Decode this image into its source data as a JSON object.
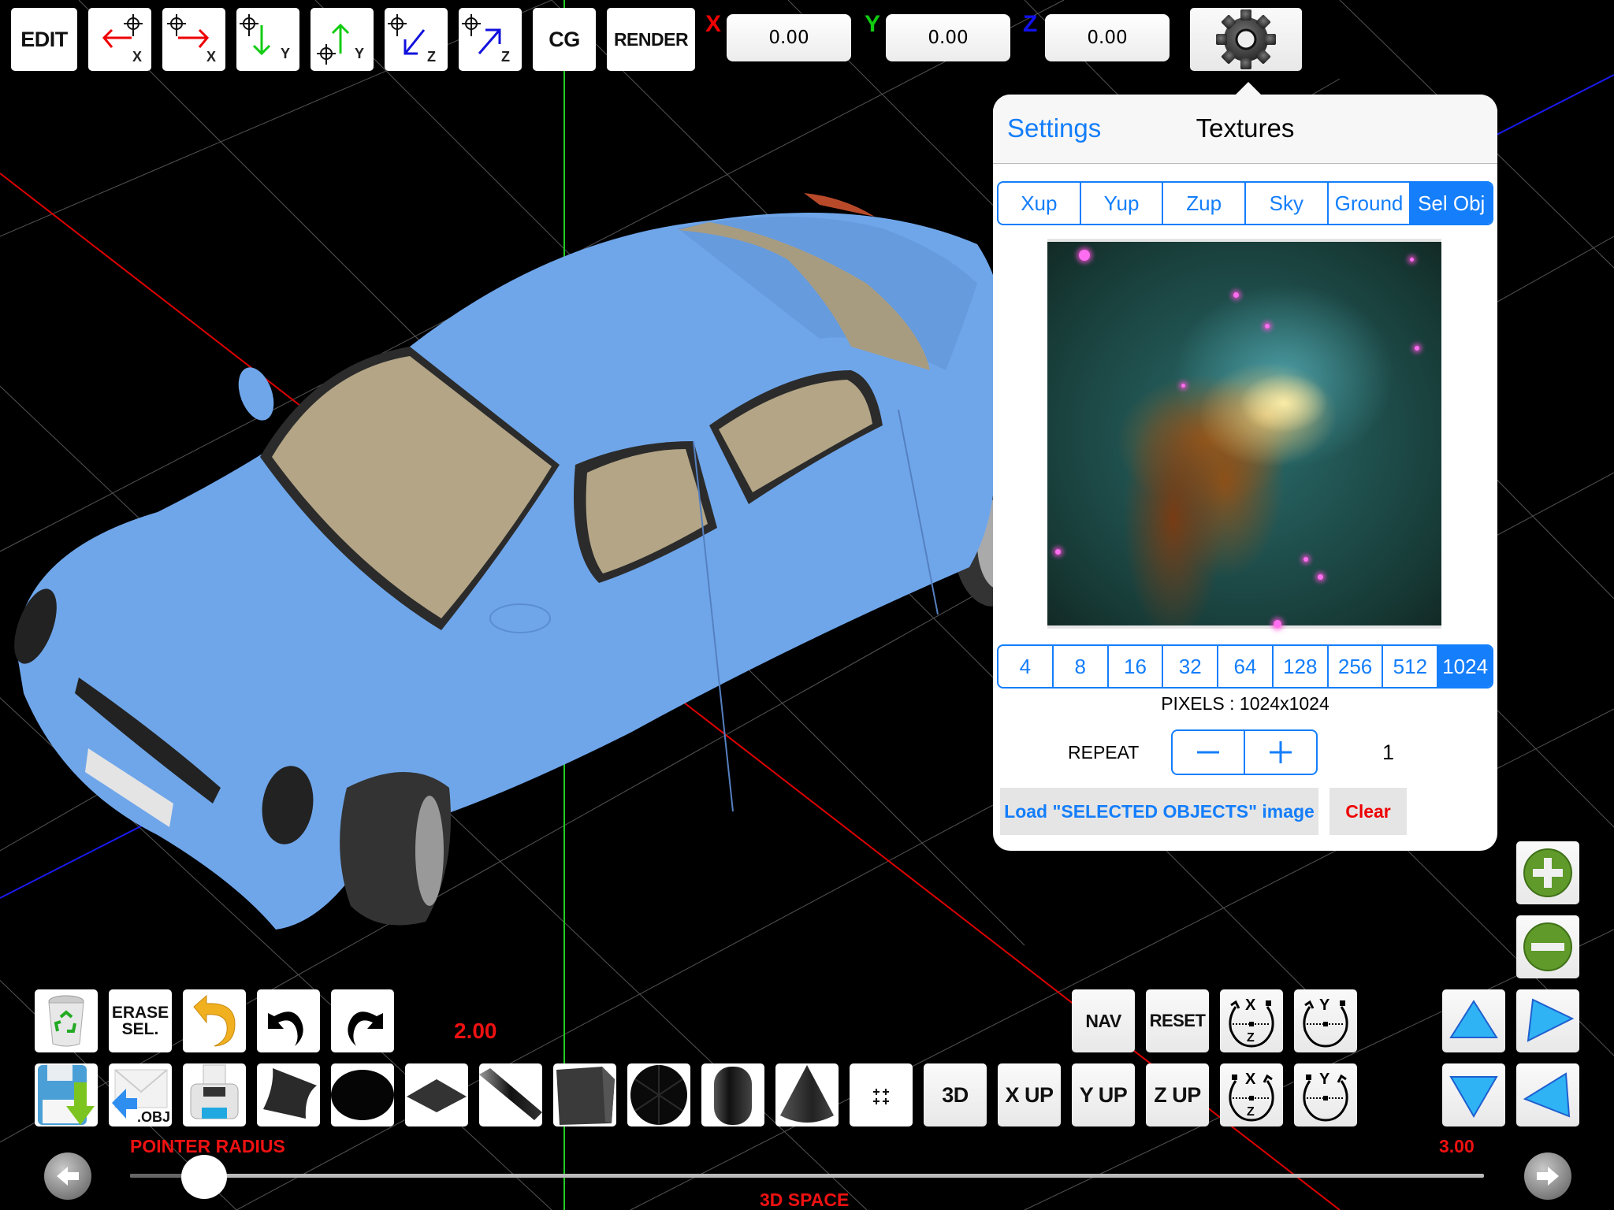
{
  "toolbar": {
    "edit": "EDIT",
    "cg": "CG",
    "render": "RENDER",
    "move_buttons": [
      {
        "axis": "X",
        "direction": "left"
      },
      {
        "axis": "X",
        "direction": "right"
      },
      {
        "axis": "Y",
        "direction": "down"
      },
      {
        "axis": "Y",
        "direction": "up"
      },
      {
        "axis": "Z",
        "direction": "toward"
      },
      {
        "axis": "Z",
        "direction": "away"
      }
    ],
    "coords": {
      "x_label": "X",
      "x_value": "0.00",
      "y_label": "Y",
      "y_value": "0.00",
      "z_label": "Z",
      "z_value": "0.00"
    },
    "settings_icon": "gear-icon"
  },
  "popover": {
    "back_label": "Settings",
    "title": "Textures",
    "texture_tabs": [
      "Xup",
      "Yup",
      "Zup",
      "Sky",
      "Ground",
      "Sel Obj"
    ],
    "texture_tab_active": "Sel Obj",
    "preview_description": "Nebula pillar texture image",
    "size_options": [
      "4",
      "8",
      "16",
      "32",
      "64",
      "128",
      "256",
      "512",
      "1024"
    ],
    "size_active": "1024",
    "pixels_label": "PIXELS : 1024x1024",
    "repeat_label": "REPEAT",
    "repeat_value": "1",
    "load_button": "Load \"SELECTED OBJECTS\" image",
    "clear_button": "Clear"
  },
  "bottom": {
    "erase_sel": [
      "ERASE",
      "SEL."
    ],
    "export_obj_label": ".OBJ",
    "value_top": "2.00",
    "nav": "NAV",
    "reset": "RESET",
    "grid_toggle": "++\n++",
    "view_3d": "3D",
    "x_up": "X UP",
    "y_up": "Y UP",
    "z_up": "Z UP",
    "rotate_axes": [
      "X/Z",
      "Y"
    ],
    "pointer_radius_label": "POINTER RADIUS",
    "slider_value_right": "3.00",
    "slider_fraction": 0.055,
    "space_label": "3D SPACE"
  },
  "colors": {
    "accent": "#147efb",
    "axis_x": "#ff0000",
    "axis_y": "#00cc00",
    "axis_z": "#0000ff",
    "car_body": "#6fa6ea",
    "label_red": "#ee1111"
  }
}
